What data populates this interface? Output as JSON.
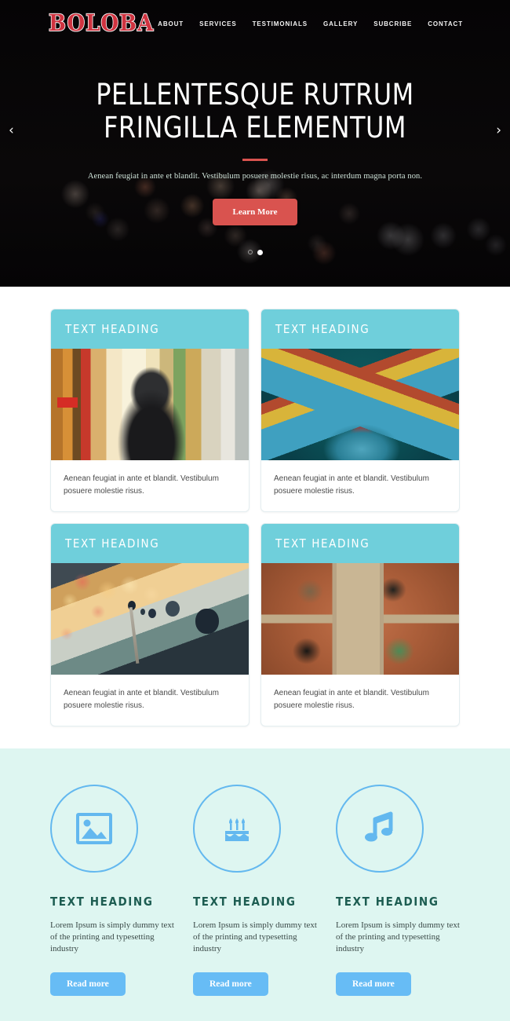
{
  "site": {
    "logo": "BOLOBA",
    "accent_red": "#d9534f",
    "accent_teal": "#6fcfdb",
    "accent_blue": "#67bcf5",
    "features_bg": "#def6f1"
  },
  "nav": {
    "items": [
      {
        "label": "ABOUT"
      },
      {
        "label": "SERVICES"
      },
      {
        "label": "TESTIMONIALS"
      },
      {
        "label": "GALLERY"
      },
      {
        "label": "SUBCRIBE"
      },
      {
        "label": "CONTACT"
      }
    ]
  },
  "hero": {
    "title": "PELLENTESQUE RUTRUM FRINGILLA ELEMENTUM",
    "subtitle": "Aenean feugiat in ante et blandit. Vestibulum posuere molestie risus, ac interdum magna porta non.",
    "button_label": "Learn More",
    "prev_icon": "chevron-left-icon",
    "prev_glyph": "‹",
    "next_icon": "chevron-right-icon",
    "next_glyph": "›",
    "slides": [
      {
        "active": false
      },
      {
        "active": true
      }
    ]
  },
  "cards": [
    {
      "heading": "TEXT HEADING",
      "text": "Aenean feugiat in ante et blandit. Vestibulum posuere molestie risus.",
      "image": "city-street-hooded-figure"
    },
    {
      "heading": "TEXT HEADING",
      "text": "Aenean feugiat in ante et blandit. Vestibulum posuere molestie risus.",
      "image": "macaw-wings"
    },
    {
      "heading": "TEXT HEADING",
      "text": "Aenean feugiat in ante et blandit. Vestibulum posuere molestie risus.",
      "image": "bicycle-handlebar-bokeh"
    },
    {
      "heading": "TEXT HEADING",
      "text": "Aenean feugiat in ante et blandit. Vestibulum posuere molestie risus.",
      "image": "overhead-table-meeting"
    }
  ],
  "features": [
    {
      "icon": "image-icon",
      "heading": "TEXT HEADING",
      "text": "Lorem Ipsum is simply dummy text of the printing and typesetting industry",
      "button_label": "Read more"
    },
    {
      "icon": "birthday-cake-icon",
      "heading": "TEXT HEADING",
      "text": "Lorem Ipsum is simply dummy text of the printing and typesetting industry",
      "button_label": "Read more"
    },
    {
      "icon": "music-note-icon",
      "heading": "TEXT HEADING",
      "text": "Lorem Ipsum is simply dummy text of the printing and typesetting industry",
      "button_label": "Read more"
    }
  ]
}
